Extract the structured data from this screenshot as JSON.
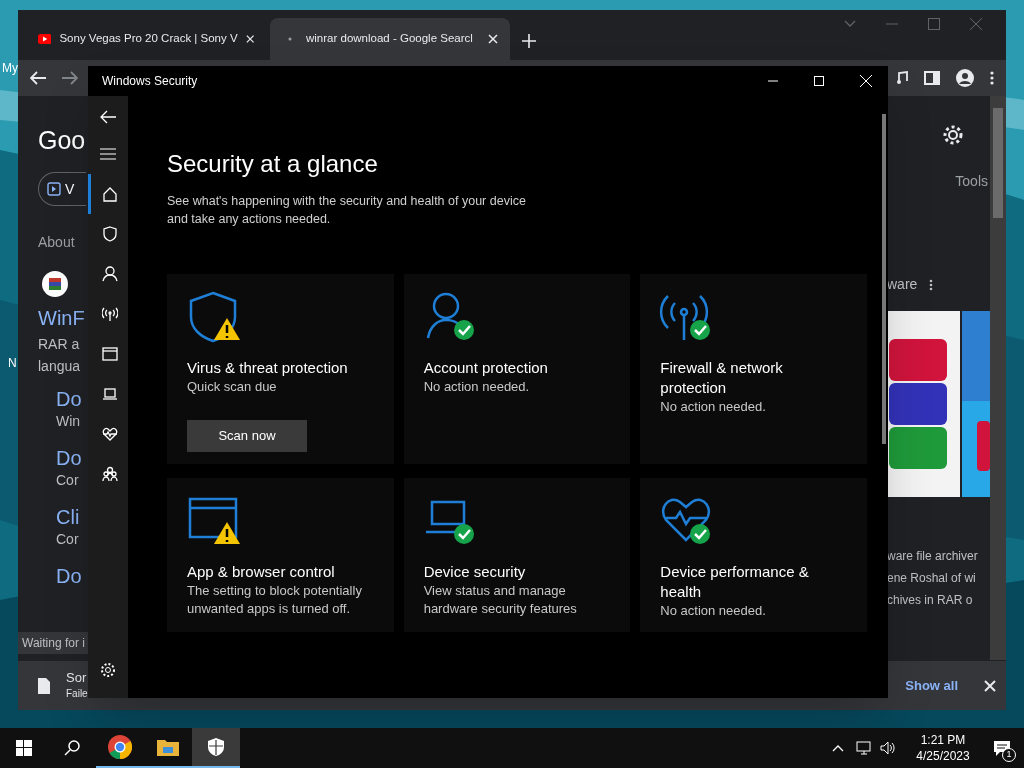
{
  "desktop": {
    "icon_labels": [
      "My",
      "N"
    ]
  },
  "browser": {
    "tabs": [
      {
        "title": "Sony Vegas Pro 20 Crack | Sony V",
        "selected": false,
        "kind": "video"
      },
      {
        "title": "winrar download - Google Searcl",
        "selected": true,
        "kind": "loading"
      }
    ],
    "page_left": {
      "logo": "Goo",
      "chip": "V",
      "about": "About",
      "result_title": "WinF",
      "snippet": [
        "RAR a",
        "langua"
      ],
      "sitelinks": [
        {
          "title": "Do",
          "sub": "Win"
        },
        {
          "title": "Do",
          "sub": "Cor"
        },
        {
          "title": "Cli",
          "sub": "Cor"
        },
        {
          "title": "Do"
        }
      ]
    },
    "page_right": {
      "tools": "Tools",
      "panel_title": "ware",
      "snippet": [
        "ware file archiver",
        "ene Roshal of wi",
        "chives in RAR o"
      ]
    },
    "status_tooltip": "Waiting for i",
    "download": {
      "file": "Sor",
      "status": "Faile",
      "show_all": "Show all"
    }
  },
  "security": {
    "title": "Windows Security",
    "nav": [
      {
        "kind": "home",
        "selected": true
      },
      {
        "kind": "shield",
        "selected": false
      },
      {
        "kind": "person",
        "selected": false
      },
      {
        "kind": "antenna",
        "selected": false
      },
      {
        "kind": "window",
        "selected": false
      },
      {
        "kind": "laptop",
        "selected": false
      },
      {
        "kind": "heart",
        "selected": false
      },
      {
        "kind": "family",
        "selected": false
      }
    ],
    "heading": "Security at a glance",
    "description": "See what's happening with the security and health of your device and take any actions needed.",
    "cards": [
      {
        "kind": "shield",
        "warning": true,
        "title": "Virus & threat protection",
        "subtitle": "Quick scan due",
        "button": "Scan now"
      },
      {
        "kind": "person",
        "warning": false,
        "title": "Account protection",
        "subtitle": "No action needed."
      },
      {
        "kind": "antenna",
        "warning": false,
        "title": "Firewall & network protection",
        "subtitle": "No action needed."
      },
      {
        "kind": "window",
        "warning": true,
        "title": "App & browser control",
        "subtitle": "The setting to block potentially unwanted apps is turned off."
      },
      {
        "kind": "laptop",
        "warning": false,
        "title": "Device security",
        "subtitle": "View status and manage hardware security features"
      },
      {
        "kind": "heart",
        "warning": false,
        "title": "Device performance & health",
        "subtitle": "No action needed."
      }
    ]
  },
  "taskbar": {
    "apps": [
      {
        "kind": "chrome",
        "selected": false
      },
      {
        "kind": "folder",
        "selected": false
      },
      {
        "kind": "shield",
        "selected": true
      }
    ],
    "time": "1:21 PM",
    "date": "4/25/2023",
    "notifications": "1"
  }
}
